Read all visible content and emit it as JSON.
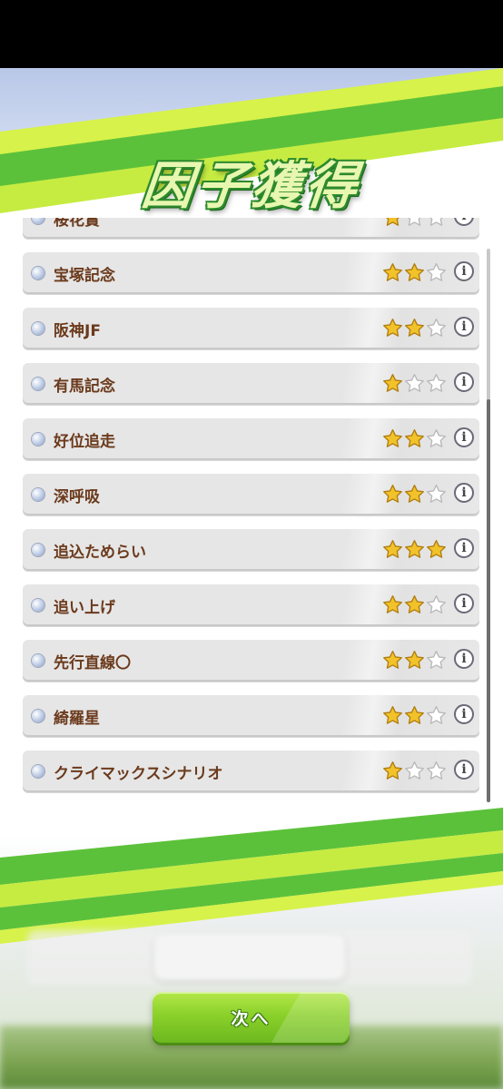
{
  "dialog": {
    "title": "因子獲得"
  },
  "factors": [
    {
      "name": "桜花賞",
      "stars": 1
    },
    {
      "name": "宝塚記念",
      "stars": 2
    },
    {
      "name": "阪神JF",
      "stars": 2
    },
    {
      "name": "有馬記念",
      "stars": 1
    },
    {
      "name": "好位追走",
      "stars": 2
    },
    {
      "name": "深呼吸",
      "stars": 2
    },
    {
      "name": "追込ためらい",
      "stars": 3
    },
    {
      "name": "追い上げ",
      "stars": 2
    },
    {
      "name": "先行直線〇",
      "stars": 2
    },
    {
      "name": "綺羅星",
      "stars": 2
    },
    {
      "name": "クライマックスシナリオ",
      "stars": 1
    }
  ],
  "info_glyph": "i",
  "max_stars": 3,
  "next_button": {
    "label": "次へ"
  },
  "colors": {
    "accent_green": "#8bd12a",
    "label_brown": "#6b3a1c",
    "star_gold": "#f2c22a",
    "stripe_green": "#5cc13a",
    "stripe_lime": "#d7f24a"
  },
  "icons": {
    "bullet": "bullet-dot-icon",
    "star_filled": "star-filled-icon",
    "star_empty": "star-empty-icon",
    "info": "info-icon"
  }
}
